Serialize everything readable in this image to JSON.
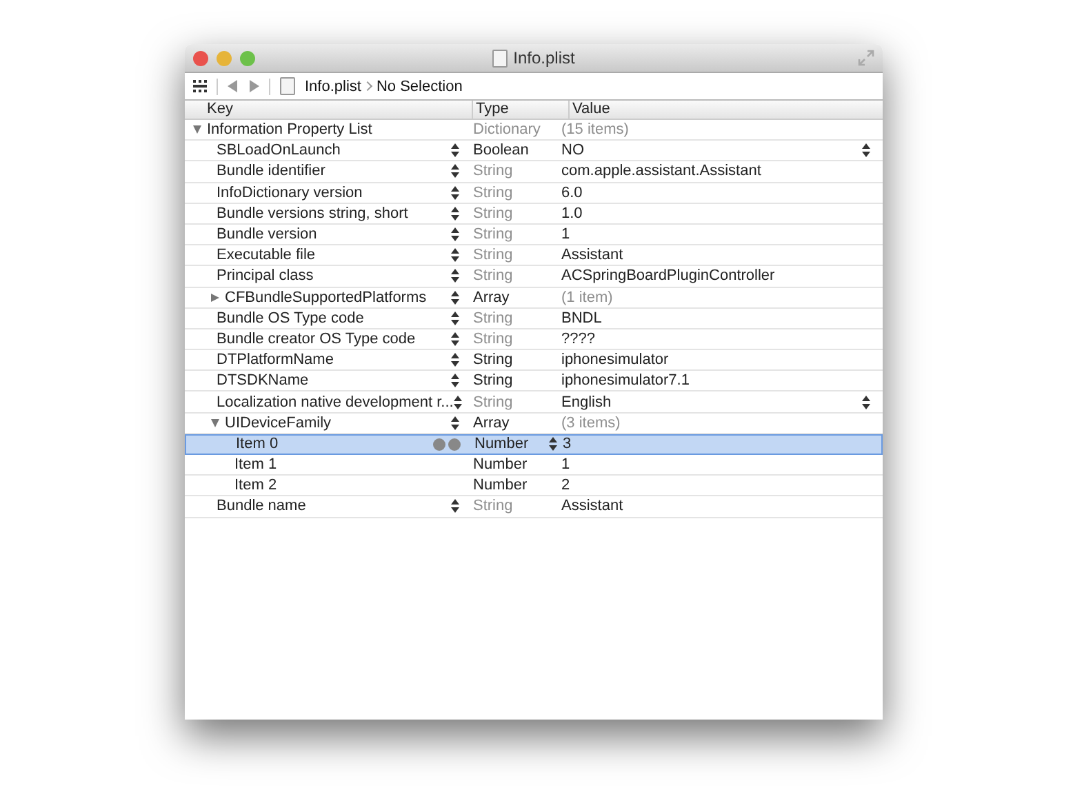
{
  "window": {
    "title": "Info.plist"
  },
  "breadcrumb": {
    "file": "Info.plist",
    "selection": "No Selection"
  },
  "columns": [
    "Key",
    "Type",
    "Value"
  ],
  "rows": [
    {
      "key": "Information Property List",
      "type": "Dictionary",
      "value": "(15 items)",
      "type_greyed": true,
      "value_greyed": true,
      "expanded": true,
      "selected": false,
      "children": [
        {
          "key": "SBLoadOnLaunch",
          "type": "Boolean",
          "value": "NO",
          "type_greyed": false,
          "value_greyed": false,
          "selected": false,
          "value_popup": true
        },
        {
          "key": "Bundle identifier",
          "type": "String",
          "value": "com.apple.assistant.Assistant",
          "type_greyed": true,
          "value_greyed": false,
          "selected": false
        },
        {
          "key": "InfoDictionary version",
          "type": "String",
          "value": "6.0",
          "type_greyed": true,
          "value_greyed": false,
          "selected": false
        },
        {
          "key": "Bundle versions string, short",
          "type": "String",
          "value": "1.0",
          "type_greyed": true,
          "value_greyed": false,
          "selected": false
        },
        {
          "key": "Bundle version",
          "type": "String",
          "value": "1",
          "type_greyed": true,
          "value_greyed": false,
          "selected": false
        },
        {
          "key": "Executable file",
          "type": "String",
          "value": "Assistant",
          "type_greyed": true,
          "value_greyed": false,
          "selected": false
        },
        {
          "key": "Principal class",
          "type": "String",
          "value": "ACSpringBoardPluginController",
          "type_greyed": true,
          "value_greyed": false,
          "selected": false
        },
        {
          "key": "CFBundleSupportedPlatforms",
          "type": "Array",
          "value": "(1 item)",
          "type_greyed": false,
          "value_greyed": true,
          "expanded": false,
          "selected": false
        },
        {
          "key": "Bundle OS Type code",
          "type": "String",
          "value": "BNDL",
          "type_greyed": true,
          "value_greyed": false,
          "selected": false
        },
        {
          "key": "Bundle creator OS Type code",
          "type": "String",
          "value": "????",
          "type_greyed": true,
          "value_greyed": false,
          "selected": false
        },
        {
          "key": "DTPlatformName",
          "type": "String",
          "value": "iphonesimulator",
          "type_greyed": false,
          "value_greyed": false,
          "selected": false
        },
        {
          "key": "DTSDKName",
          "type": "String",
          "value": "iphonesimulator7.1",
          "type_greyed": false,
          "value_greyed": false,
          "selected": false
        },
        {
          "key": "Localization native development r...",
          "type": "String",
          "value": "English",
          "type_greyed": true,
          "value_greyed": false,
          "selected": false,
          "value_popup": true
        },
        {
          "key": "UIDeviceFamily",
          "type": "Array",
          "value": "(3 items)",
          "type_greyed": false,
          "value_greyed": true,
          "expanded": true,
          "selected": false,
          "children": [
            {
              "key": "Item 0",
              "type": "Number",
              "value": "3",
              "type_greyed": false,
              "value_greyed": false,
              "selected": true
            },
            {
              "key": "Item 1",
              "type": "Number",
              "value": "1",
              "type_greyed": false,
              "value_greyed": false,
              "selected": false
            },
            {
              "key": "Item 2",
              "type": "Number",
              "value": "2",
              "type_greyed": false,
              "value_greyed": false,
              "selected": false
            }
          ]
        },
        {
          "key": "Bundle name",
          "type": "String",
          "value": "Assistant",
          "type_greyed": true,
          "value_greyed": false,
          "selected": false
        }
      ]
    }
  ]
}
